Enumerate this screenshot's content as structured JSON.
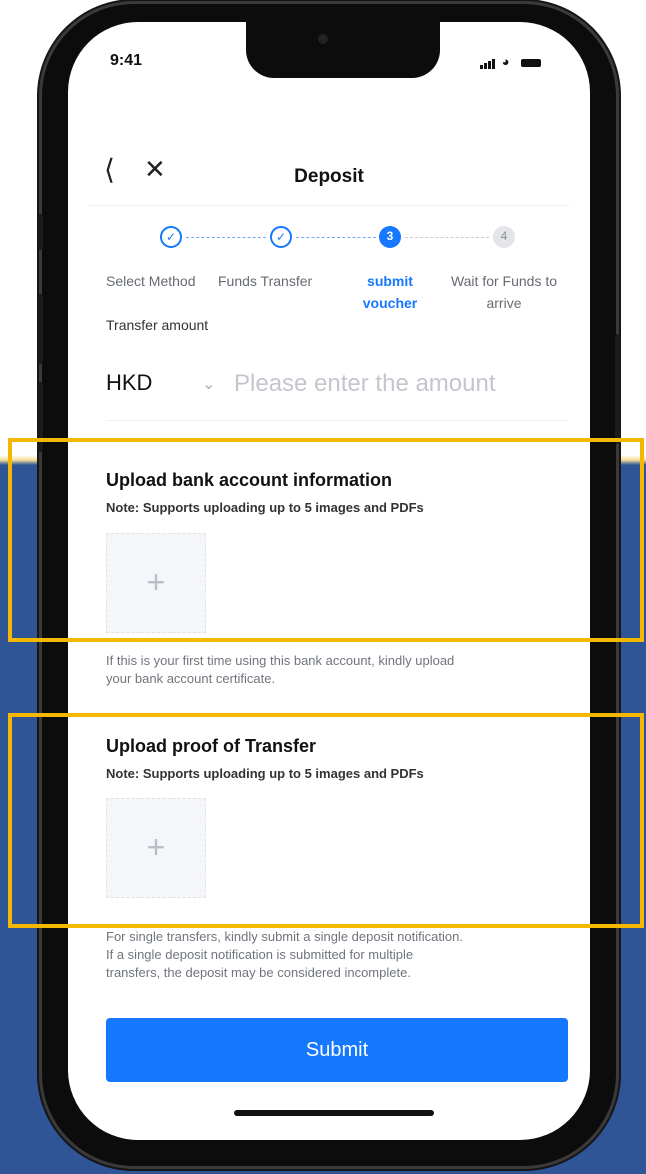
{
  "status": {
    "time": "9:41"
  },
  "header": {
    "title": "Deposit",
    "back_icon": "chevron-left-icon",
    "close_icon": "close-icon"
  },
  "stepper": {
    "steps": [
      {
        "label": "Select Method",
        "state": "done"
      },
      {
        "label": "Funds Transfer",
        "state": "done"
      },
      {
        "label_line1": "submit",
        "label_line2": "voucher",
        "number": "3",
        "state": "active"
      },
      {
        "label_line1": "Wait for Funds to",
        "label_line2": "arrive",
        "number": "4",
        "state": "todo"
      }
    ]
  },
  "amount": {
    "label": "Transfer amount",
    "currency": "HKD",
    "placeholder": "Please enter the amount"
  },
  "bank_info": {
    "title": "Upload bank account information",
    "note": "Note: Supports uploading up to 5 images and PDFs",
    "help_line1": "If this is your first time using this bank account, kindly upload",
    "help_line2": "your bank account certificate."
  },
  "proof": {
    "title": "Upload proof of Transfer",
    "note": "Note: Supports uploading up to 5 images and PDFs",
    "help_line1": "For single transfers, kindly submit a single deposit notification.",
    "help_line2": "If a single deposit notification is submitted for multiple",
    "help_line3": "transfers, the deposit may be considered incomplete."
  },
  "submit_label": "Submit",
  "colors": {
    "accent": "#1677ff",
    "highlight": "#f5b800",
    "background": "#2f5597"
  }
}
